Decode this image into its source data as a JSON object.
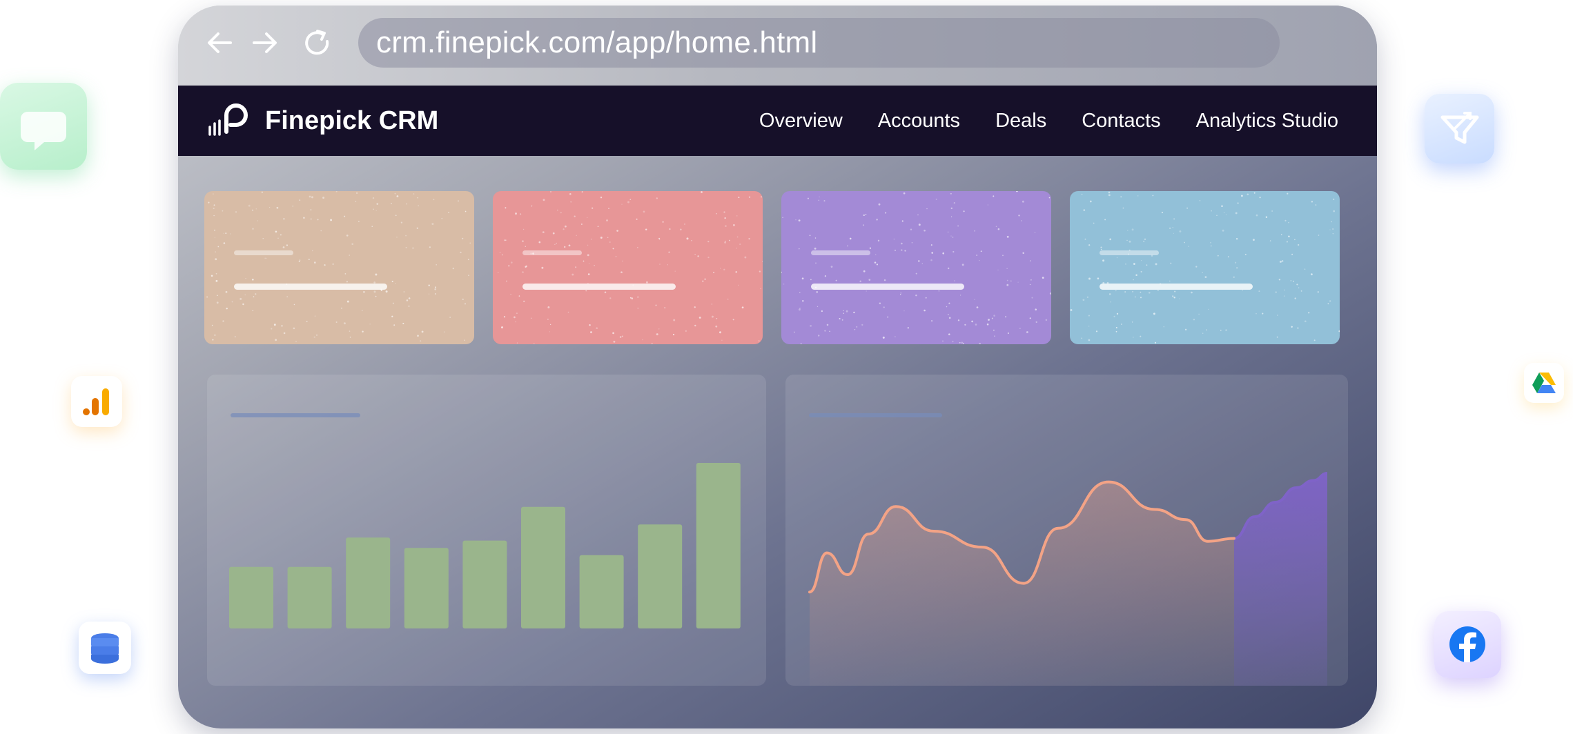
{
  "browser": {
    "url": "crm.finepick.com/app/home.html",
    "nav_icons": [
      "back-arrow-icon",
      "forward-arrow-icon",
      "reload-icon"
    ]
  },
  "app": {
    "brand": "Finepick CRM",
    "nav": [
      "Overview",
      "Accounts",
      "Deals",
      "Contacts",
      "Analytics Studio"
    ]
  },
  "stat_cards": [
    {
      "color": "#d8bca6"
    },
    {
      "color": "#e79697"
    },
    {
      "color": "#a38ad6"
    },
    {
      "color": "#92c0d8"
    }
  ],
  "integrations": [
    "chat-bubble-icon",
    "google-analytics-icon",
    "database-icon",
    "funnel-icon",
    "google-drive-icon",
    "facebook-icon"
  ],
  "colors": {
    "bar": "#9ab58c",
    "line": "#f3a386",
    "forecast_fill": "#7f63c8"
  },
  "chart_data": [
    {
      "type": "bar",
      "values": [
        42,
        42,
        62,
        55,
        60,
        83,
        50,
        71,
        113
      ]
    },
    {
      "type": "line",
      "x": [
        0,
        1,
        2,
        3,
        4,
        5,
        6,
        7,
        8,
        9,
        10,
        11,
        12,
        13,
        14,
        15,
        16,
        17,
        18,
        19,
        20
      ],
      "values": [
        38,
        65,
        50,
        78,
        97,
        80,
        69,
        44,
        82,
        114,
        95,
        88,
        73,
        75,
        90,
        100,
        110,
        115,
        120,
        0,
        0
      ],
      "note_series": "forecast"
    }
  ]
}
